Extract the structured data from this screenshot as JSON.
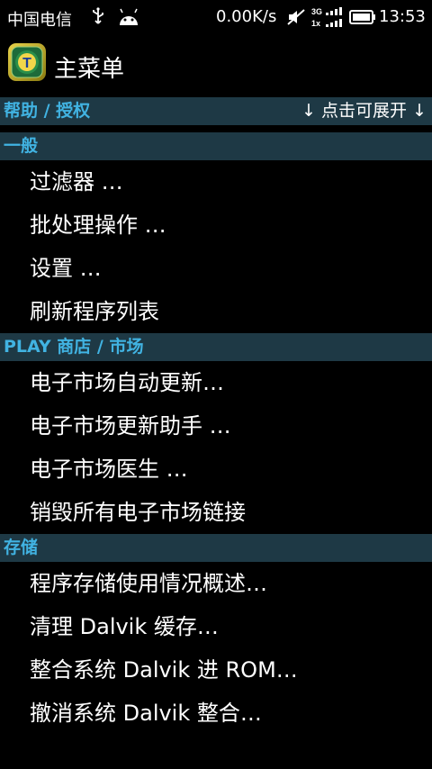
{
  "status_bar": {
    "carrier": "中国电信",
    "net_speed": "0.00K/s",
    "time": "13:53",
    "icons": [
      "usb-icon",
      "android-icon",
      "mute-icon",
      "signal-3g-1x-icon",
      "battery-icon"
    ]
  },
  "header": {
    "title": "主菜单",
    "app_icon": "titanium-backup-icon",
    "app_icon_letter": "T"
  },
  "sections": [
    {
      "label": "帮助 / 授权",
      "right_label": "↓ 点击可展开 ↓",
      "items": []
    },
    {
      "label": "一般",
      "items": [
        "过滤器 …",
        "批处理操作 …",
        "设置 …",
        "刷新程序列表"
      ]
    },
    {
      "label": "PLAY 商店 / 市场",
      "items": [
        "电子市场自动更新…",
        "电子市场更新助手 …",
        "电子市场医生 …",
        "销毁所有电子市场链接"
      ]
    },
    {
      "label": "存储",
      "items": [
        "程序存储使用情况概述…",
        "清理 Dalvik 缓存…",
        "整合系统 Dalvik 进 ROM…",
        "撤消系统 Dalvik 整合…"
      ]
    }
  ]
}
